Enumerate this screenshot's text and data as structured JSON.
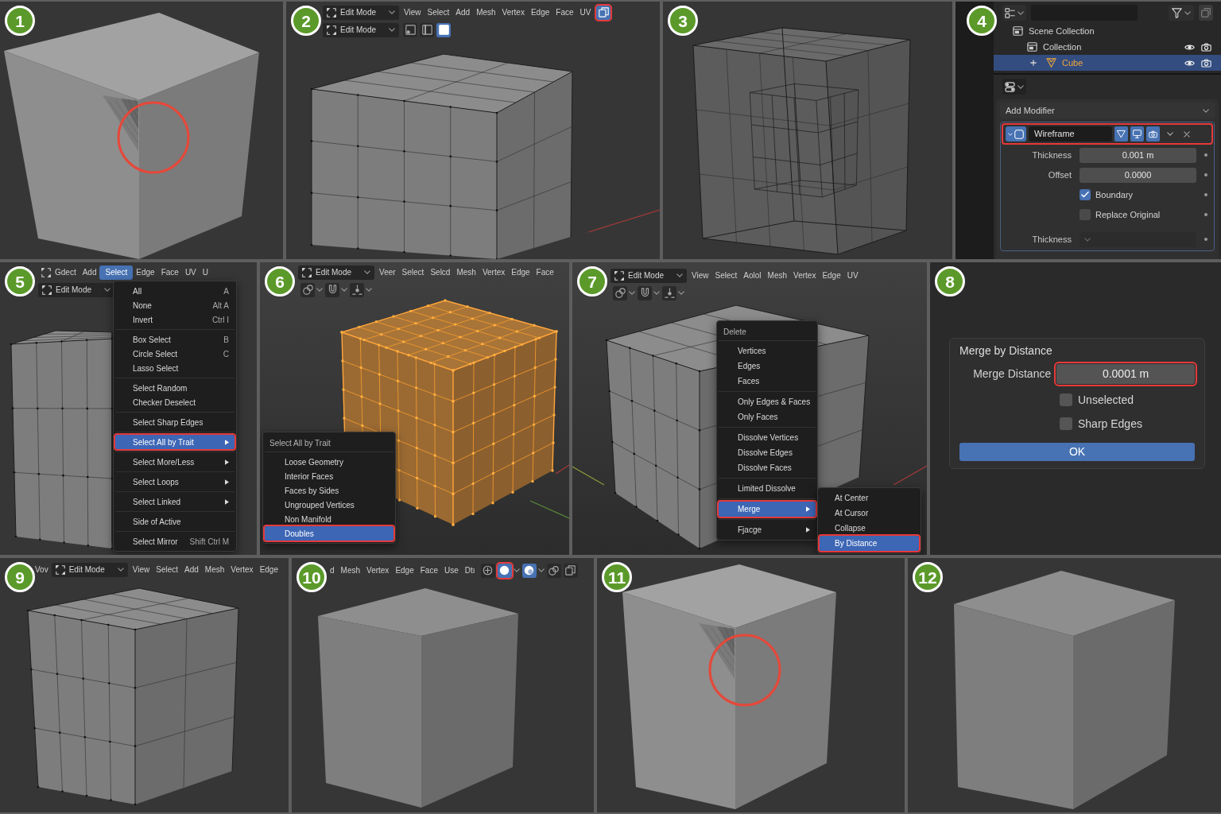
{
  "panels": [
    {
      "kind": "viewport",
      "badge": "1",
      "cube": {
        "kind": "artifact"
      },
      "ring": true
    },
    {
      "kind": "viewport",
      "badge": "2",
      "cube": {
        "kind": "grid"
      },
      "ring": false,
      "header": [
        [
          {
            "kind": "mode",
            "label": "Edit Mode"
          },
          {
            "kind": "menu",
            "label": "View",
            "selected": false
          },
          {
            "kind": "menu",
            "label": "Select",
            "selected": false
          },
          {
            "kind": "menu",
            "label": "Add",
            "selected": false
          },
          {
            "kind": "menu",
            "label": "Mesh",
            "selected": false
          },
          {
            "kind": "menu",
            "label": "Vertex",
            "selected": false
          },
          {
            "kind": "menu",
            "label": "Edge",
            "selected": false
          },
          {
            "kind": "menu",
            "label": "Face",
            "selected": false
          },
          {
            "kind": "menu",
            "label": "UV",
            "selected": false
          },
          {
            "kind": "xray",
            "on": true,
            "highlighted": true
          }
        ],
        [
          {
            "kind": "mode",
            "label": "Edit Mode"
          },
          {
            "kind": "vertex-select",
            "on": false,
            "highlighted": false
          },
          {
            "kind": "edge-select",
            "on": false,
            "highlighted": false
          },
          {
            "kind": "face-select",
            "on": true,
            "highlighted": false
          }
        ]
      ]
    },
    {
      "kind": "viewport",
      "badge": "3",
      "cube": {
        "kind": "xray"
      },
      "ring": false
    },
    {
      "kind": "outliner",
      "badge": "4",
      "tree": [
        {
          "kind": "scene",
          "label": "Scene Collection",
          "selected": false,
          "collapsed": false,
          "children": [
            {
              "kind": "collection",
              "label": "Collection",
              "selected": false,
              "collapsed": false,
              "children": [
                {
                  "kind": "object",
                  "label": "Cube",
                  "selected": true,
                  "collapsed": true
                }
              ]
            }
          ]
        }
      ],
      "add_modifier": "Add Modifier",
      "modifier": {
        "name": "Wireframe",
        "highlighted": true,
        "toggles": [
          {
            "kind": "edit-mode",
            "on": true
          },
          {
            "kind": "realtime",
            "on": true
          },
          {
            "kind": "render",
            "on": true
          }
        ],
        "fields": [
          {
            "kind": "number",
            "label": "Thickness",
            "value": "0.001 m"
          },
          {
            "kind": "number",
            "label": "Offset",
            "value": "0.0000"
          },
          {
            "kind": "checkbox",
            "label": "Boundary",
            "checked": true
          },
          {
            "kind": "checkbox",
            "label": "Replace Original",
            "checked": false
          },
          {
            "kind": "dropdown",
            "label": "Thickness"
          }
        ]
      }
    },
    {
      "kind": "viewport",
      "badge": "5",
      "cube": {
        "kind": "grid"
      },
      "ring": false,
      "header": [
        [
          {
            "kind": "iconmenu",
            "label": "Gdect"
          },
          {
            "kind": "menu",
            "label": "Add",
            "selected": false
          },
          {
            "kind": "menu",
            "label": "Select",
            "selected": true
          },
          {
            "kind": "menu",
            "label": "Edge",
            "selected": false
          },
          {
            "kind": "menu",
            "label": "Face",
            "selected": false
          },
          {
            "kind": "menu",
            "label": "UV",
            "selected": false
          },
          {
            "kind": "menu",
            "label": "U",
            "selected": false
          }
        ],
        [
          {
            "kind": "mode",
            "label": "Edit Mode"
          }
        ]
      ],
      "popup": {
        "groups": [
          [
            {
              "label": "All",
              "shortcut": "A",
              "submenu": false,
              "selected": false
            },
            {
              "label": "None",
              "shortcut": "Alt A",
              "submenu": false,
              "selected": false
            },
            {
              "label": "Invert",
              "shortcut": "Ctrl I",
              "submenu": false,
              "selected": false
            }
          ],
          [
            {
              "label": "Box Select",
              "shortcut": "B",
              "submenu": false,
              "selected": false
            },
            {
              "label": "Circle Select",
              "shortcut": "C",
              "submenu": false,
              "selected": false
            },
            {
              "label": "Lasso Select",
              "submenu": false,
              "selected": false
            }
          ],
          [
            {
              "label": "Select Random",
              "submenu": false,
              "selected": false
            },
            {
              "label": "Checker Deselect",
              "submenu": false,
              "selected": false
            }
          ],
          [
            {
              "label": "Select Sharp Edges",
              "submenu": false,
              "selected": false
            }
          ],
          [
            {
              "label": "Select All by Trait",
              "submenu": true,
              "selected": true
            }
          ],
          [
            {
              "label": "Select More/Less",
              "submenu": true,
              "selected": false
            }
          ],
          [
            {
              "label": "Select Loops",
              "submenu": true,
              "selected": false
            }
          ],
          [
            {
              "label": "Select Linked",
              "submenu": true,
              "selected": false
            }
          ],
          [
            {
              "label": "Side of Active",
              "submenu": false,
              "selected": false
            }
          ],
          [
            {
              "label": "Select Mirror",
              "shortcut": "Shift Ctrl M",
              "submenu": false,
              "selected": false
            }
          ]
        ]
      }
    },
    {
      "kind": "viewport",
      "badge": "6",
      "cube": {
        "kind": "selected"
      },
      "ring": false,
      "header": [
        [
          {
            "kind": "mode",
            "label": "Edit Mode"
          },
          {
            "kind": "menu",
            "label": "Veer",
            "selected": false
          },
          {
            "kind": "menu",
            "label": "Select",
            "selected": false
          },
          {
            "kind": "menu",
            "label": "Selcd",
            "selected": false
          },
          {
            "kind": "menu",
            "label": "Mesh",
            "selected": false
          },
          {
            "kind": "menu",
            "label": "Vertex",
            "selected": false
          },
          {
            "kind": "menu",
            "label": "Edge",
            "selected": false
          },
          {
            "kind": "menu",
            "label": "Face",
            "selected": false
          }
        ],
        [
          {
            "kind": "pivot",
            "on": false,
            "highlighted": false
          },
          {
            "kind": "snap",
            "on": false,
            "highlighted": false
          },
          {
            "kind": "proportional",
            "on": false,
            "highlighted": false
          }
        ]
      ],
      "popup": {
        "title": "Select All by Trait",
        "groups": [
          [
            {
              "label": "Loose Geometry",
              "submenu": false,
              "selected": false
            },
            {
              "label": "Interior Faces",
              "submenu": false,
              "selected": false
            },
            {
              "label": "Faces by Sides",
              "submenu": false,
              "selected": false
            },
            {
              "label": "Ungrouped Vertices",
              "submenu": false,
              "selected": false
            },
            {
              "label": "Non Manifold",
              "submenu": false,
              "selected": false
            },
            {
              "label": "Doubles",
              "submenu": false,
              "selected": true
            }
          ]
        ]
      }
    },
    {
      "kind": "viewport",
      "badge": "7",
      "cube": {
        "kind": "grid"
      },
      "ring": false,
      "header": [
        [
          {
            "kind": "mode",
            "label": "Edit Mode"
          },
          {
            "kind": "menu",
            "label": "View",
            "selected": false
          },
          {
            "kind": "menu",
            "label": "Select",
            "selected": false
          },
          {
            "kind": "menu",
            "label": "Aolol",
            "selected": false
          },
          {
            "kind": "menu",
            "label": "Mesh",
            "selected": false
          },
          {
            "kind": "menu",
            "label": "Vertex",
            "selected": false
          },
          {
            "kind": "menu",
            "label": "Edge",
            "selected": false
          },
          {
            "kind": "menu",
            "label": "UV",
            "selected": false
          }
        ],
        [
          {
            "kind": "pivot",
            "on": false,
            "highlighted": false
          },
          {
            "kind": "snap",
            "on": false,
            "highlighted": false
          },
          {
            "kind": "proportional",
            "on": false,
            "highlighted": false
          }
        ]
      ],
      "popup": {
        "title": "Delete",
        "groups": [
          [
            {
              "label": "Vertices",
              "submenu": false,
              "selected": false
            },
            {
              "label": "Edges",
              "submenu": false,
              "selected": false
            },
            {
              "label": "Faces",
              "submenu": false,
              "selected": false
            }
          ],
          [
            {
              "label": "Only Edges & Faces",
              "submenu": false,
              "selected": false
            },
            {
              "label": "Only Faces",
              "submenu": false,
              "selected": false
            }
          ],
          [
            {
              "label": "Dissolve Vertices",
              "submenu": false,
              "selected": false
            },
            {
              "label": "Dissolve Edges",
              "submenu": false,
              "selected": false
            },
            {
              "label": "Dissolve Faces",
              "submenu": false,
              "selected": false
            }
          ],
          [
            {
              "label": "Limited Dissolve",
              "submenu": false,
              "selected": false
            }
          ],
          [
            {
              "label": "Merge",
              "submenu": true,
              "selected": true
            }
          ],
          [
            {
              "label": "Fjacge",
              "submenu": true,
              "selected": false
            }
          ]
        ]
      },
      "submenu": {
        "groups": [
          [
            {
              "label": "At Center",
              "submenu": false,
              "selected": false
            },
            {
              "label": "At Cursor",
              "submenu": false,
              "selected": false
            },
            {
              "label": "Collapse",
              "submenu": false,
              "selected": false
            },
            {
              "label": "By Distance",
              "submenu": false,
              "selected": true
            }
          ]
        ]
      }
    },
    {
      "kind": "dialog",
      "badge": "8",
      "title": "Merge by Distance",
      "field": {
        "label": "Merge Distance",
        "value": "0.0001 m",
        "highlighted": true
      },
      "options": [
        {
          "label": "Unselected",
          "checked": false
        },
        {
          "label": "Sharp Edges",
          "checked": false
        }
      ],
      "button": "OK"
    },
    {
      "kind": "viewport",
      "badge": "9",
      "cube": {
        "kind": "grid"
      },
      "ring": false,
      "header": [
        [
          {
            "kind": "menu",
            "label": "Vov",
            "selected": false
          },
          {
            "kind": "mode",
            "label": "Edit Mode"
          },
          {
            "kind": "menu",
            "label": "View",
            "selected": false
          },
          {
            "kind": "menu",
            "label": "Select",
            "selected": false
          },
          {
            "kind": "menu",
            "label": "Add",
            "selected": false
          },
          {
            "kind": "menu",
            "label": "Mesh",
            "selected": false
          },
          {
            "kind": "menu",
            "label": "Vertex",
            "selected": false
          },
          {
            "kind": "menu",
            "label": "Edge",
            "selected": false
          }
        ]
      ]
    },
    {
      "kind": "viewport",
      "badge": "10",
      "cube": {
        "kind": "smooth"
      },
      "ring": false,
      "header": [
        [
          {
            "kind": "menu",
            "label": "d",
            "selected": false
          },
          {
            "kind": "menu",
            "label": "Mesh",
            "selected": false
          },
          {
            "kind": "menu",
            "label": "Vertex",
            "selected": false
          },
          {
            "kind": "menu",
            "label": "Edge",
            "selected": false
          },
          {
            "kind": "menu",
            "label": "Face",
            "selected": false
          },
          {
            "kind": "menu",
            "label": "Use",
            "selected": false
          },
          {
            "kind": "menu",
            "label": "Dtı",
            "selected": false
          },
          {
            "kind": "gizmo",
            "on": false,
            "highlighted": false
          },
          {
            "kind": "shading-solid",
            "on": true,
            "highlighted": true
          },
          {
            "kind": "shading-material",
            "on": true,
            "highlighted": false
          },
          {
            "kind": "overlay",
            "on": false,
            "highlighted": false
          },
          {
            "kind": "xray",
            "on": false,
            "highlighted": false
          }
        ]
      ]
    },
    {
      "kind": "viewport",
      "badge": "11",
      "cube": {
        "kind": "artifact"
      },
      "ring": true
    },
    {
      "kind": "viewport",
      "badge": "12",
      "cube": {
        "kind": "smooth"
      },
      "ring": false
    }
  ]
}
